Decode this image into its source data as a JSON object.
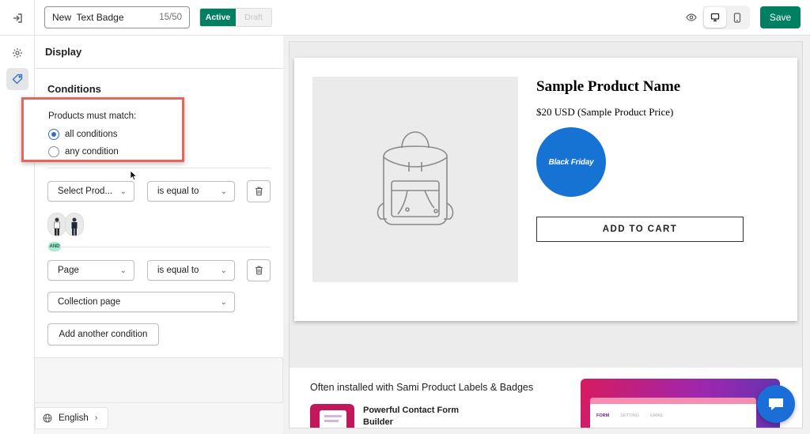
{
  "topbar": {
    "badge_name": "New  Text Badge",
    "char_count": "15/50",
    "status_active": "Active",
    "status_draft": "Draft",
    "save_label": "Save"
  },
  "panel": {
    "title": "Display",
    "conditions_title": "Conditions",
    "match_label": "Products must match:",
    "match_all": "all conditions",
    "match_any": "any condition",
    "rule1_field": "Select Prod...",
    "rule1_operator": "is equal to",
    "and_label": "AND",
    "rule2_field": "Page",
    "rule2_operator": "is equal to",
    "rule2_value": "Collection page",
    "add_condition": "Add another condition",
    "language": "English"
  },
  "preview": {
    "product_name": "Sample Product Name",
    "product_price": "$20 USD (Sample Product Price)",
    "badge_text": "Black Friday",
    "badge_color": "#1673d4",
    "add_to_cart": "ADD TO CART",
    "promo_title": "Often installed with Sami Product Labels & Badges",
    "promo_app_name": "Powerful Contact Form Builder",
    "banner_tabs": [
      "FORM",
      "SETTING",
      "EMAIL"
    ]
  },
  "colors": {
    "primary": "#008060",
    "highlight_border": "#e4665c",
    "radio_selected": "#2c6ecb"
  }
}
